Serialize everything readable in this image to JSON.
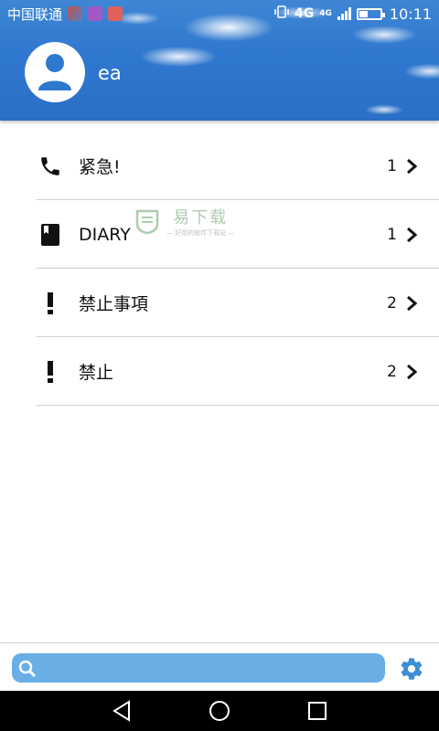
{
  "status_bar": {
    "carrier": "中国联通",
    "network": "4G",
    "network_small": "4G",
    "time": "10:11"
  },
  "profile": {
    "username": "ea"
  },
  "list": [
    {
      "icon": "phone-icon",
      "label": "紧急!",
      "count": "1"
    },
    {
      "icon": "book-icon",
      "label": "DIARY",
      "count": "1"
    },
    {
      "icon": "exclamation-icon",
      "label": "禁止事項",
      "count": "2"
    },
    {
      "icon": "exclamation-icon",
      "label": "禁止",
      "count": "2"
    }
  ],
  "watermark": {
    "title": "易下载",
    "subtitle": "— 好用的软件下载站 —"
  },
  "search": {
    "placeholder": ""
  },
  "colors": {
    "header_blue": "#2f78cf",
    "search_blue": "#6aaee6",
    "settings_blue": "#3a8fd8"
  }
}
